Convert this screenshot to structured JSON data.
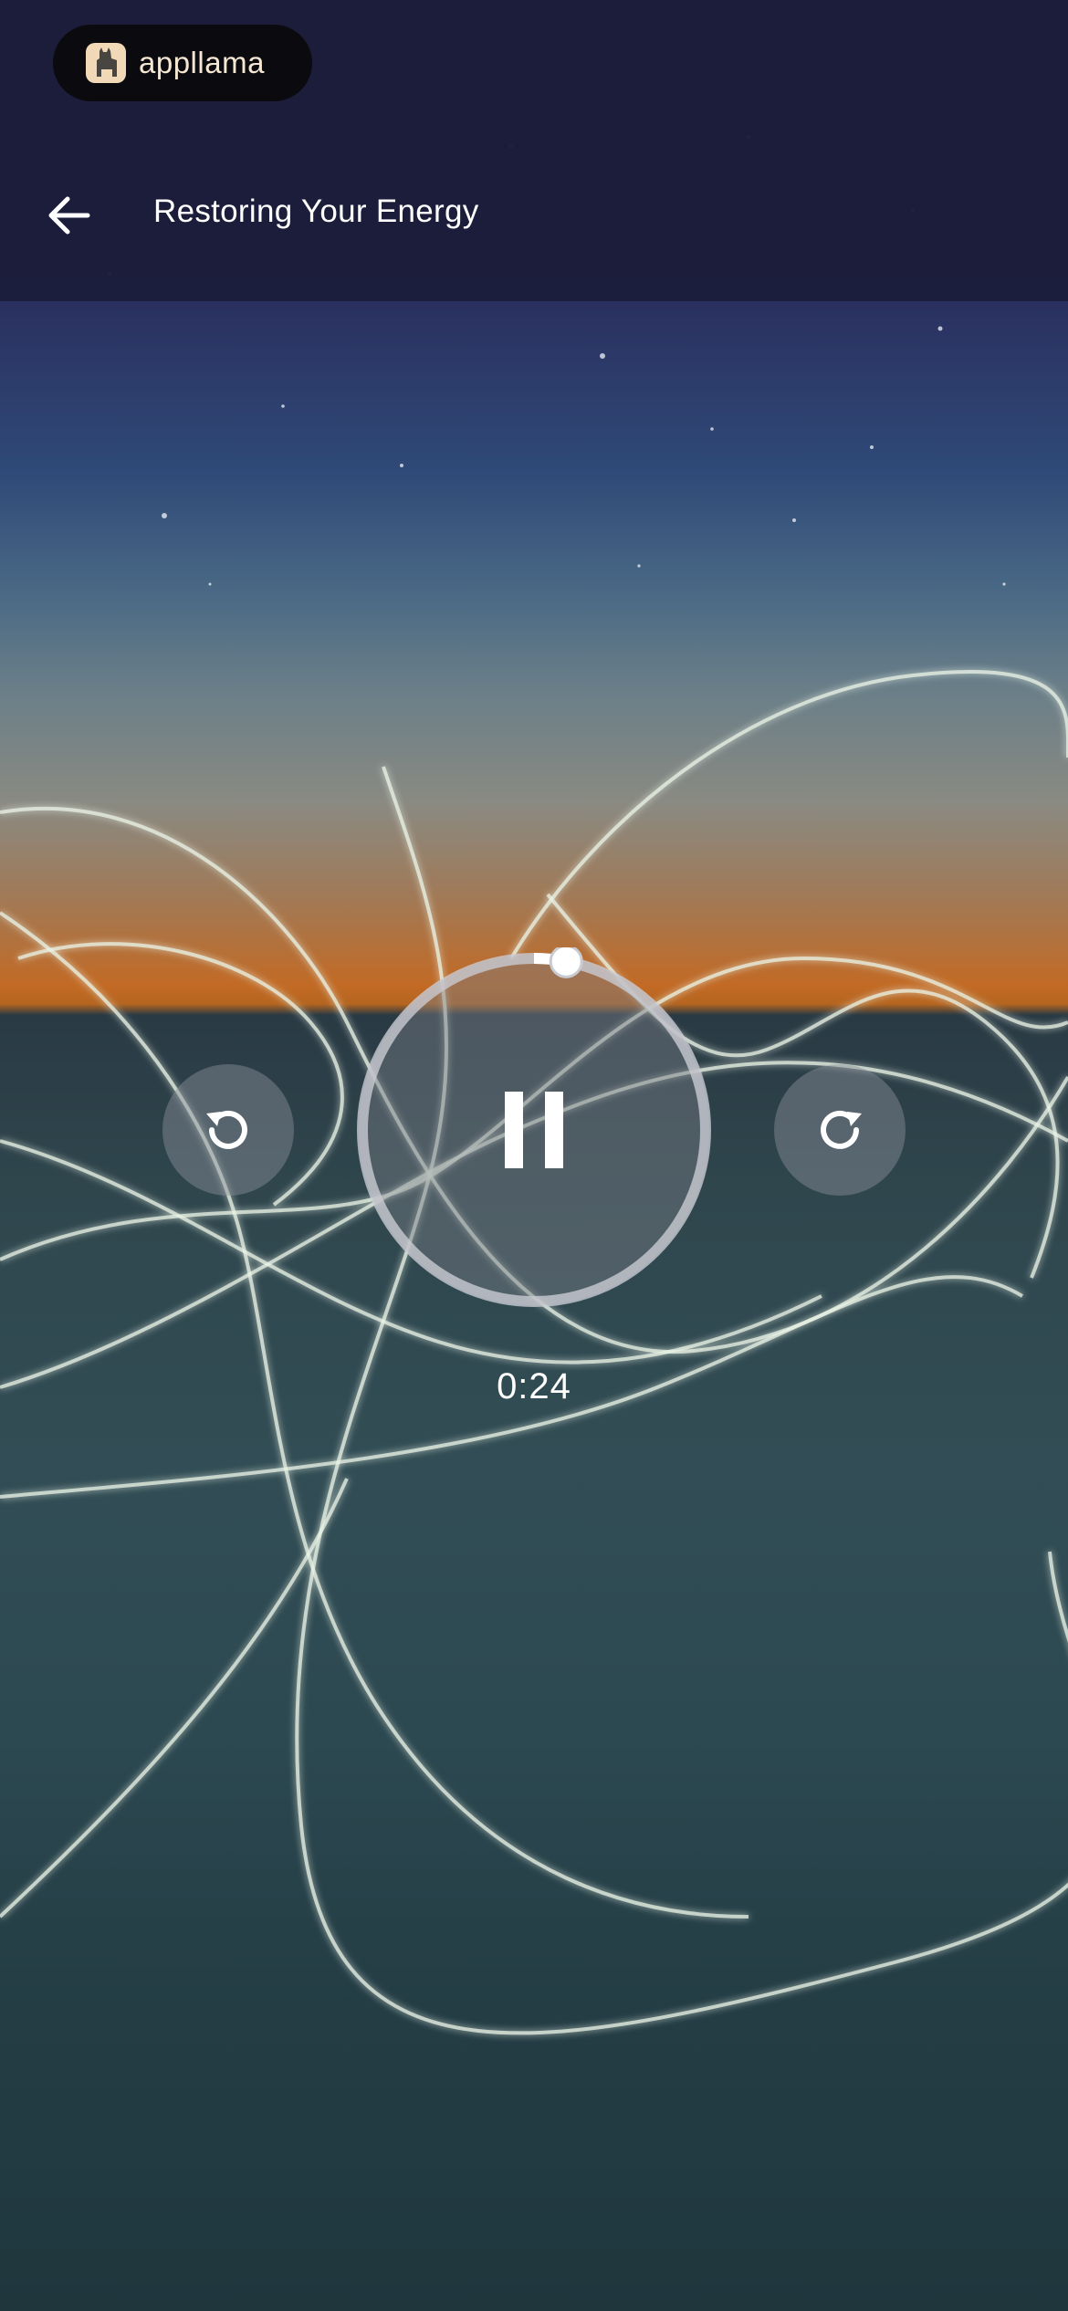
{
  "brand": {
    "name": "appllama",
    "logo_icon": "llama-icon"
  },
  "header": {
    "back_icon": "arrow-left-icon",
    "title": "Restoring Your Energy"
  },
  "player": {
    "state": "playing",
    "elapsed": "0:24",
    "progress_fraction": 0.03,
    "rewind_icon": "rewind-icon",
    "forward_icon": "fast-forward-icon",
    "pause_icon": "pause-icon"
  },
  "colors": {
    "header_bg": "#1b1d3a",
    "accent": "#ffffff",
    "ring": "#c9cbd2"
  }
}
